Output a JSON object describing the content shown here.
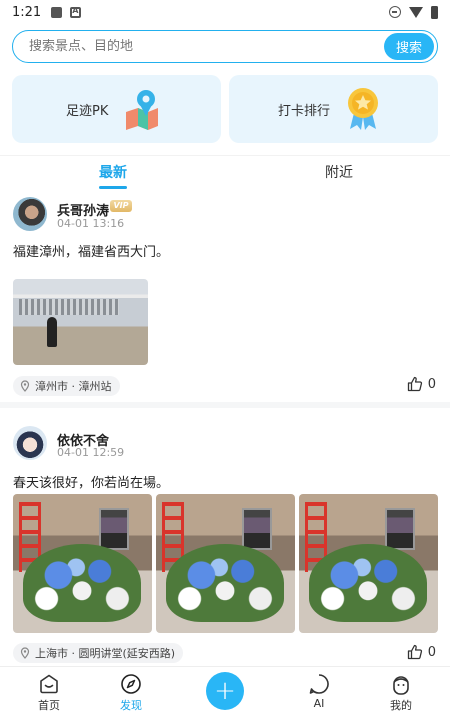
{
  "status_bar": {
    "time": "1:21"
  },
  "search": {
    "placeholder": "搜索景点、目的地",
    "button": "搜索"
  },
  "features": [
    {
      "label": "足迹PK",
      "icon": "map-pin-icon"
    },
    {
      "label": "打卡排行",
      "icon": "medal-icon"
    }
  ],
  "tabs": [
    {
      "label": "最新",
      "active": true
    },
    {
      "label": "附近",
      "active": false
    }
  ],
  "posts": [
    {
      "user": "兵哥孙涛",
      "vip": "VIP",
      "time": "04-01 13:16",
      "text": "福建漳州，福建省西大门。",
      "location": "漳州市 · 漳州站",
      "likes": "0"
    },
    {
      "user": "依依不舍",
      "time": "04-01 12:59",
      "text": "春天该很好，你若尚在場。",
      "location": "上海市 · 圆明讲堂(延安西路)",
      "likes": "0"
    }
  ],
  "nav": {
    "home": "首页",
    "discover": "发现",
    "ai": "AI",
    "mine": "我的"
  },
  "colors": {
    "accent": "#29b6f6",
    "card_bg": "#e8f5fd"
  }
}
